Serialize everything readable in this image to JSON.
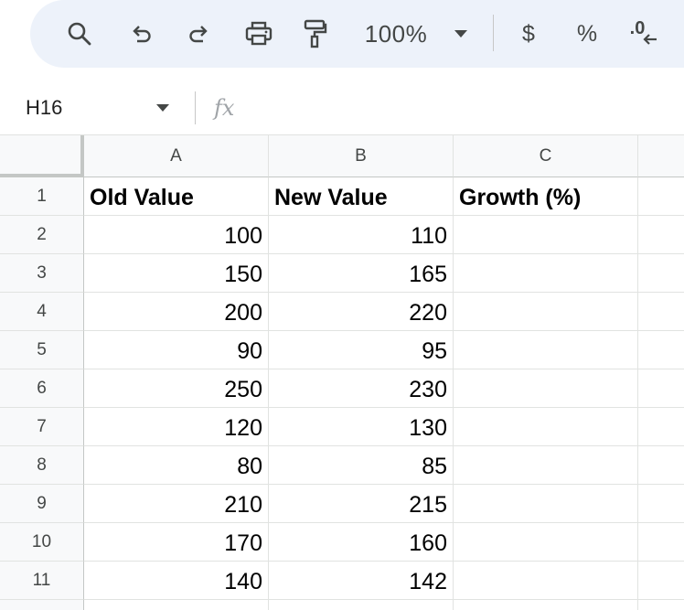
{
  "toolbar": {
    "zoom": "100%",
    "currency_symbol": "$",
    "percent_symbol": "%",
    "decrease_decimal_symbol": ".0"
  },
  "formula_bar": {
    "name_box": "H16",
    "fx_label": "fx",
    "formula": ""
  },
  "columns": [
    "A",
    "B",
    "C",
    ""
  ],
  "rows": [
    {
      "num": "1",
      "cells": [
        "Old Value",
        "New Value",
        "Growth (%)",
        ""
      ]
    },
    {
      "num": "2",
      "cells": [
        "100",
        "110",
        "",
        ""
      ]
    },
    {
      "num": "3",
      "cells": [
        "150",
        "165",
        "",
        ""
      ]
    },
    {
      "num": "4",
      "cells": [
        "200",
        "220",
        "",
        ""
      ]
    },
    {
      "num": "5",
      "cells": [
        "90",
        "95",
        "",
        ""
      ]
    },
    {
      "num": "6",
      "cells": [
        "250",
        "230",
        "",
        ""
      ]
    },
    {
      "num": "7",
      "cells": [
        "120",
        "130",
        "",
        ""
      ]
    },
    {
      "num": "8",
      "cells": [
        "80",
        "85",
        "",
        ""
      ]
    },
    {
      "num": "9",
      "cells": [
        "210",
        "215",
        "",
        ""
      ]
    },
    {
      "num": "10",
      "cells": [
        "170",
        "160",
        "",
        ""
      ]
    },
    {
      "num": "11",
      "cells": [
        "140",
        "142",
        "",
        ""
      ]
    },
    {
      "num": "",
      "cells": [
        "",
        "",
        "",
        ""
      ]
    }
  ]
}
